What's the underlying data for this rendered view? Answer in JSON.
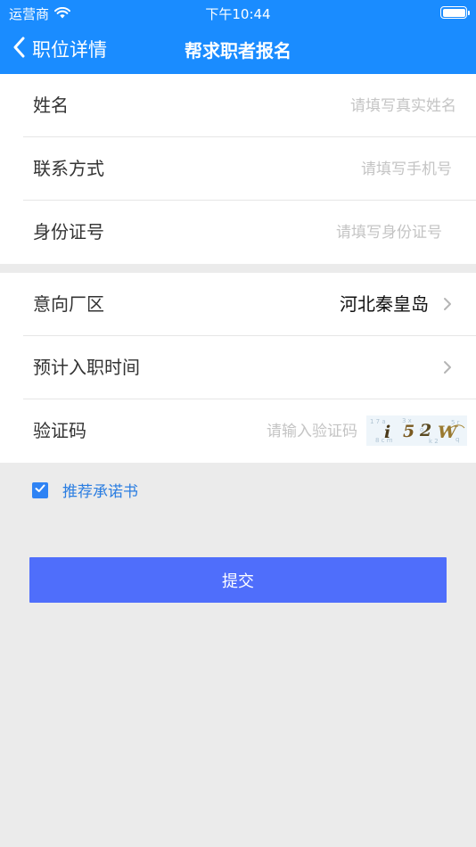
{
  "status_bar": {
    "carrier": "运营商",
    "time": "下午10:44"
  },
  "nav": {
    "back_label": "职位详情",
    "title": "帮求职者报名"
  },
  "form": {
    "name": {
      "label": "姓名",
      "placeholder": "请填写真实姓名",
      "value": ""
    },
    "phone": {
      "label": "联系方式",
      "placeholder": "请填写手机号",
      "value": ""
    },
    "id_number": {
      "label": "身份证号",
      "placeholder": "请填写身份证号",
      "value": ""
    },
    "factory_area": {
      "label": "意向厂区",
      "value": "河北秦皇岛"
    },
    "start_date": {
      "label": "预计入职时间",
      "value": ""
    },
    "captcha": {
      "label": "验证码",
      "placeholder": "请输入验证码",
      "value": "",
      "image_text": "i52W"
    }
  },
  "agreement": {
    "checked": true,
    "link_label": "推荐承诺书"
  },
  "submit_label": "提交",
  "colors": {
    "header_bg": "#1a8cff",
    "submit_bg": "#4f6efb",
    "link": "#2a7de1",
    "page_bg": "#ebebeb"
  }
}
